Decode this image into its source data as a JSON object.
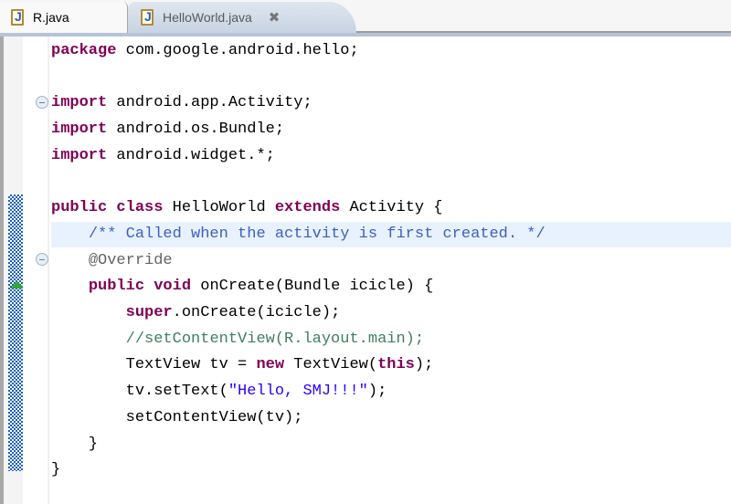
{
  "tabs": [
    {
      "label": "R.java",
      "icon": "java-file-icon",
      "active": false
    },
    {
      "label": "HelloWorld.java",
      "icon": "java-file-icon",
      "active": true,
      "close_icon": "close-icon"
    }
  ],
  "editor": {
    "highlighted_line": 7,
    "lines": [
      [
        {
          "t": "kw",
          "v": "package"
        },
        {
          "t": "",
          "v": " com.google.android.hello;"
        }
      ],
      [],
      [
        {
          "t": "kw",
          "v": "import"
        },
        {
          "t": "",
          "v": " android.app.Activity;"
        }
      ],
      [
        {
          "t": "kw",
          "v": "import"
        },
        {
          "t": "",
          "v": " android.os.Bundle;"
        }
      ],
      [
        {
          "t": "kw",
          "v": "import"
        },
        {
          "t": "",
          "v": " android.widget.*;"
        }
      ],
      [],
      [
        {
          "t": "kw",
          "v": "public"
        },
        {
          "t": "",
          "v": " "
        },
        {
          "t": "kw",
          "v": "class"
        },
        {
          "t": "",
          "v": " HelloWorld "
        },
        {
          "t": "kw",
          "v": "extends"
        },
        {
          "t": "",
          "v": " Activity {"
        }
      ],
      [
        {
          "t": "",
          "v": "    "
        },
        {
          "t": "jdoc",
          "v": "/** Called when the activity is first created. */"
        }
      ],
      [
        {
          "t": "",
          "v": "    "
        },
        {
          "t": "ann",
          "v": "@Override"
        }
      ],
      [
        {
          "t": "",
          "v": "    "
        },
        {
          "t": "kw",
          "v": "public"
        },
        {
          "t": "",
          "v": " "
        },
        {
          "t": "kw",
          "v": "void"
        },
        {
          "t": "",
          "v": " onCreate(Bundle icicle) {"
        }
      ],
      [
        {
          "t": "",
          "v": "        "
        },
        {
          "t": "kw",
          "v": "super"
        },
        {
          "t": "",
          "v": ".onCreate(icicle);"
        }
      ],
      [
        {
          "t": "",
          "v": "        "
        },
        {
          "t": "cmt",
          "v": "//setContentView(R.layout.main);"
        }
      ],
      [
        {
          "t": "",
          "v": "        TextView tv = "
        },
        {
          "t": "kw",
          "v": "new"
        },
        {
          "t": "",
          "v": " TextView("
        },
        {
          "t": "kw",
          "v": "this"
        },
        {
          "t": "",
          "v": ");"
        }
      ],
      [
        {
          "t": "",
          "v": "        tv.setText("
        },
        {
          "t": "str",
          "v": "\"Hello, SMJ!!!\""
        },
        {
          "t": "",
          "v": ");"
        }
      ],
      [
        {
          "t": "",
          "v": "        setContentView(tv);"
        }
      ],
      [
        {
          "t": "",
          "v": "    }"
        }
      ],
      [
        {
          "t": "",
          "v": "}"
        }
      ]
    ],
    "fold_markers": [
      2,
      8
    ],
    "overview": {
      "change_marker": "quick-diff-change",
      "warning_marker": "override-indicator"
    }
  }
}
